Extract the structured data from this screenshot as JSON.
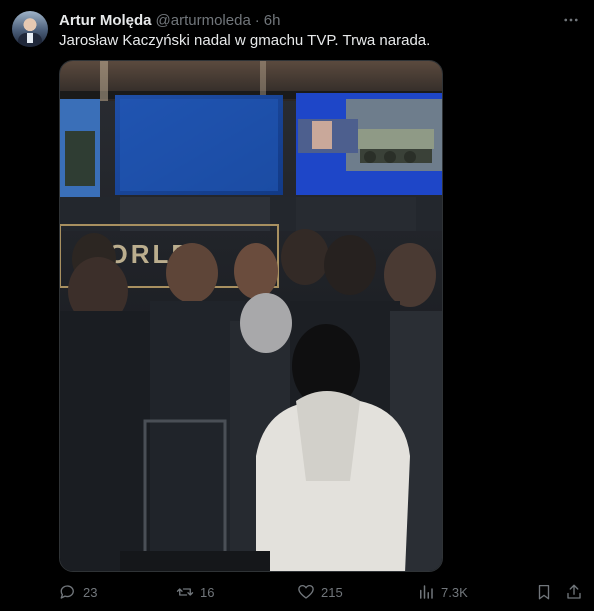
{
  "tweet": {
    "author_name": "Artur Molęda",
    "author_handle": "@arturmoleda",
    "separator": "·",
    "time": "6h",
    "text": "Jarosław Kaczyński nadal w gmachu TVP. Trwa narada.",
    "media_sign_text": "WORLD"
  },
  "actions": {
    "replies": "23",
    "reposts": "16",
    "likes": "215",
    "views": "7.3K"
  },
  "icons": {
    "more": "more-horizontal-icon",
    "reply": "reply-icon",
    "repost": "repost-icon",
    "like": "heart-icon",
    "views": "views-icon",
    "bookmark": "bookmark-icon",
    "share": "share-icon"
  },
  "colors": {
    "background": "#000000",
    "primary_text": "#e7e9ea",
    "secondary_text": "#71767b",
    "border": "#2f3336"
  }
}
